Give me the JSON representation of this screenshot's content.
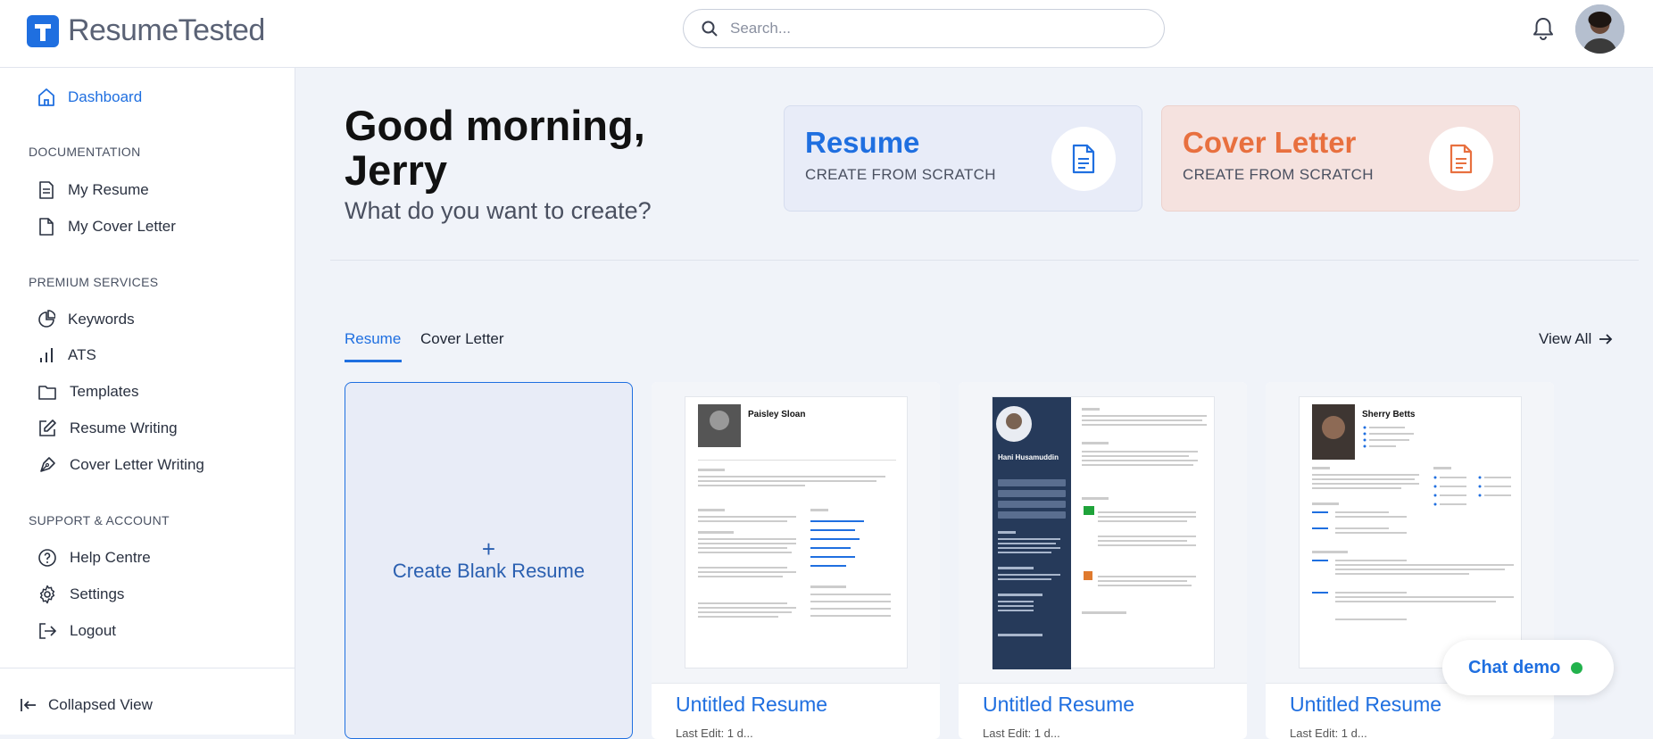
{
  "app": {
    "name": "ResumeTested"
  },
  "search": {
    "placeholder": "Search..."
  },
  "sidebar": {
    "dashboard": "Dashboard",
    "sections": {
      "documentation": "DOCUMENTATION",
      "premium": "PREMIUM SERVICES",
      "support": "SUPPORT & ACCOUNT"
    },
    "documentation": [
      {
        "label": "My Resume"
      },
      {
        "label": "My Cover Letter"
      }
    ],
    "premium": [
      {
        "label": "Keywords"
      },
      {
        "label": "ATS"
      },
      {
        "label": "Templates"
      },
      {
        "label": "Resume Writing"
      },
      {
        "label": "Cover Letter Writing"
      }
    ],
    "support": [
      {
        "label": "Help Centre"
      },
      {
        "label": "Settings"
      },
      {
        "label": "Logout"
      }
    ],
    "collapsed": "Collapsed View"
  },
  "main": {
    "greeting": "Good morning, Jerry",
    "subtitle": "What do you want to create?",
    "cards": [
      {
        "title": "Resume",
        "cta": "CREATE FROM SCRATCH",
        "color": "#1f6fe0",
        "bg": "#e8ecf8"
      },
      {
        "title": "Cover Letter",
        "cta": "CREATE FROM SCRATCH",
        "color": "#e8703f",
        "bg": "#f5e2df"
      }
    ],
    "tabs": [
      {
        "label": "Resume",
        "active": true
      },
      {
        "label": "Cover Letter",
        "active": false
      }
    ],
    "view_all": "View All",
    "blank": {
      "plus": "+",
      "label": "Create Blank Resume"
    },
    "resumes": [
      {
        "name": "Untitled Resume",
        "meta": "Last Edit: 1 d...",
        "person": "Paisley Sloan"
      },
      {
        "name": "Untitled Resume",
        "meta": "Last Edit: 1 d...",
        "person": "Hani Husamuddin"
      },
      {
        "name": "Untitled Resume",
        "meta": "Last Edit: 1 d...",
        "person": "Sherry Betts"
      }
    ]
  },
  "chat": {
    "label": "Chat demo",
    "status_color": "#22b24c"
  },
  "colors": {
    "accent": "#1f6fe0",
    "orange": "#e8703f",
    "bg": "#f0f3f9"
  },
  "icons": [
    "search-icon",
    "bell-icon",
    "home-icon",
    "document-icon",
    "pie-chart-icon",
    "bar-chart-icon",
    "folder-icon",
    "edit-icon",
    "pen-icon",
    "help-icon",
    "gear-icon",
    "logout-icon",
    "collapse-icon",
    "arrow-right-icon"
  ]
}
